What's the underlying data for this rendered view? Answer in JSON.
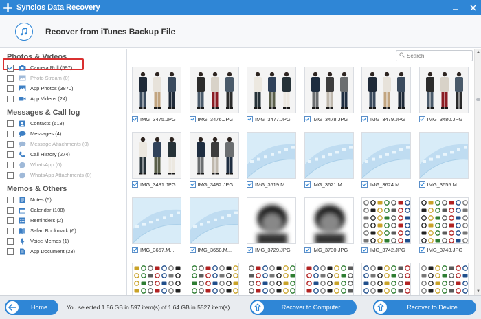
{
  "window": {
    "title": "Syncios Data Recovery",
    "controls": [
      "minimize",
      "close"
    ],
    "accent": "#2f86d6"
  },
  "header": {
    "icon": "music-note-icon",
    "title": "Recover from iTunes Backup File"
  },
  "sidebar": {
    "sections": [
      {
        "title": "Photos & Videos",
        "items": [
          {
            "label": "Camera Roll (597)",
            "icon": "camera-icon",
            "checked": true,
            "disabled": false,
            "selected": true
          },
          {
            "label": "Photo Stream (0)",
            "icon": "photo-stream-icon",
            "checked": false,
            "disabled": true,
            "selected": false
          },
          {
            "label": "App Photos (3870)",
            "icon": "app-photos-icon",
            "checked": false,
            "disabled": false,
            "selected": false
          },
          {
            "label": "App Videos (24)",
            "icon": "video-icon",
            "checked": false,
            "disabled": false,
            "selected": false
          }
        ]
      },
      {
        "title": "Messages & Call log",
        "items": [
          {
            "label": "Contacts (613)",
            "icon": "contacts-icon",
            "checked": false,
            "disabled": false
          },
          {
            "label": "Messages (4)",
            "icon": "message-icon",
            "checked": false,
            "disabled": false
          },
          {
            "label": "Message Attachments (0)",
            "icon": "attachment-icon",
            "checked": false,
            "disabled": true
          },
          {
            "label": "Call History (274)",
            "icon": "phone-icon",
            "checked": false,
            "disabled": false
          },
          {
            "label": "WhatsApp (0)",
            "icon": "whatsapp-icon",
            "checked": false,
            "disabled": true
          },
          {
            "label": "WhatsApp Attachments (0)",
            "icon": "whatsapp-attachment-icon",
            "checked": false,
            "disabled": true
          }
        ]
      },
      {
        "title": "Memos & Others",
        "items": [
          {
            "label": "Notes (5)",
            "icon": "notes-icon",
            "checked": false,
            "disabled": false
          },
          {
            "label": "Calendar (108)",
            "icon": "calendar-icon",
            "checked": false,
            "disabled": false
          },
          {
            "label": "Reminders (2)",
            "icon": "reminder-icon",
            "checked": false,
            "disabled": false
          },
          {
            "label": "Safari Bookmark (6)",
            "icon": "bookmark-icon",
            "checked": false,
            "disabled": false
          },
          {
            "label": "Voice Memos (1)",
            "icon": "microphone-icon",
            "checked": false,
            "disabled": false
          },
          {
            "label": "App Document (23)",
            "icon": "document-icon",
            "checked": false,
            "disabled": false
          }
        ]
      }
    ]
  },
  "search": {
    "placeholder": "Search",
    "icon": "search-icon"
  },
  "photos": [
    {
      "name": "IMG_3475.JPG",
      "kind": "people"
    },
    {
      "name": "IMG_3476.JPG",
      "kind": "people"
    },
    {
      "name": "IMG_3477.JPG",
      "kind": "people"
    },
    {
      "name": "IMG_3478.JPG",
      "kind": "people"
    },
    {
      "name": "IMG_3479.JPG",
      "kind": "people"
    },
    {
      "name": "IMG_3480.JPG",
      "kind": "people"
    },
    {
      "name": "IMG_3481.JPG",
      "kind": "people"
    },
    {
      "name": "IMG_3482.JPG",
      "kind": "people"
    },
    {
      "name": "IMG_3619.M...",
      "kind": "film"
    },
    {
      "name": "IMG_3621.M...",
      "kind": "film"
    },
    {
      "name": "IMG_3624.M...",
      "kind": "film"
    },
    {
      "name": "IMG_3655.M...",
      "kind": "film"
    },
    {
      "name": "IMG_3657.M...",
      "kind": "film"
    },
    {
      "name": "IMG_3658.M...",
      "kind": "film"
    },
    {
      "name": "IMG_3729.JPG",
      "kind": "blur"
    },
    {
      "name": "IMG_3730.JPG",
      "kind": "blur"
    },
    {
      "name": "IMG_3742.JPG",
      "kind": "logos"
    },
    {
      "name": "IMG_3743.JPG",
      "kind": "logos"
    },
    {
      "name": "",
      "kind": "logos"
    },
    {
      "name": "",
      "kind": "logos"
    },
    {
      "name": "",
      "kind": "logos"
    },
    {
      "name": "",
      "kind": "logos"
    },
    {
      "name": "",
      "kind": "logos"
    },
    {
      "name": "",
      "kind": "logos"
    }
  ],
  "footer": {
    "home_label": "Home",
    "home_icon": "back-arrow-icon",
    "status_text": "You selected 1.56 GB in 597 item(s) of 1.64 GB in 5527 item(s)",
    "recover_computer_label": "Recover to Computer",
    "recover_device_label": "Recover to Device",
    "upload_icon": "upload-arrow-icon"
  }
}
